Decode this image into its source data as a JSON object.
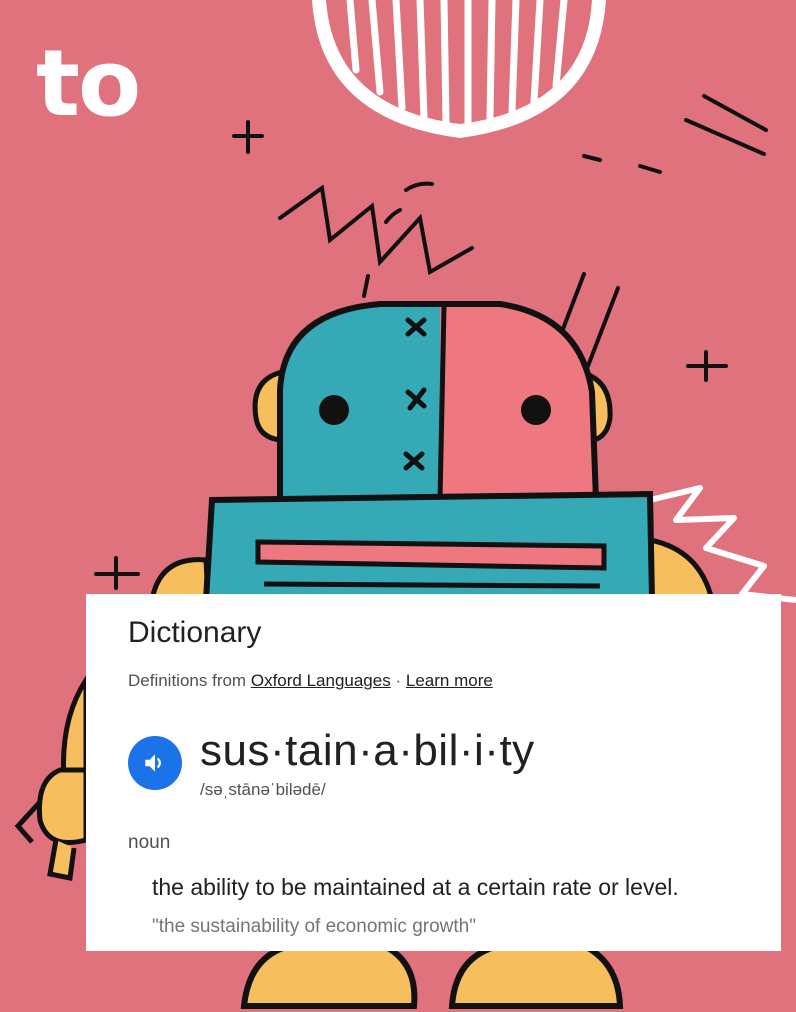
{
  "hero": {
    "word": "to"
  },
  "dictionary": {
    "title": "Dictionary",
    "source_prefix": "Definitions from",
    "source_link": "Oxford Languages",
    "separator": "·",
    "learn_more": "Learn more",
    "headword": "sus·tain·a·bil·i·ty",
    "phonetic": "/səˌstānəˈbilədē/",
    "part_of_speech": "noun",
    "definition": "the ability to be maintained at a certain rate or level.",
    "example": "\"the sustainability of economic growth\"",
    "speaker_icon": "volume-icon"
  },
  "colors": {
    "background": "#E0727E",
    "robot_teal": "#35A9B6",
    "robot_pink": "#EE7780",
    "robot_yellow": "#F7BE5E",
    "outline": "#111111",
    "speaker_blue": "#1A73E8"
  }
}
